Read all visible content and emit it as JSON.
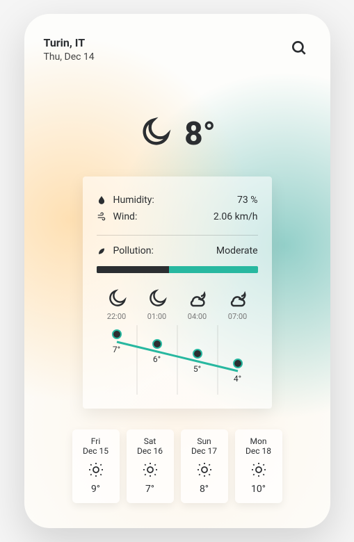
{
  "header": {
    "city": "Turin, IT",
    "date": "Thu, Dec 14"
  },
  "current": {
    "temp": "8°",
    "icon": "moon"
  },
  "details": {
    "humidity_label": "Humidity:",
    "humidity_value": "73 %",
    "wind_label": "Wind:",
    "wind_value": "2.06 km/h",
    "pollution_label": "Pollution:",
    "pollution_value": "Moderate",
    "pollution_fill_pct": 45
  },
  "hourly": [
    {
      "time": "22:00",
      "icon": "moon",
      "temp": "7°",
      "value": 7
    },
    {
      "time": "01:00",
      "icon": "moon",
      "temp": "6°",
      "value": 6
    },
    {
      "time": "04:00",
      "icon": "cloud-moon",
      "temp": "5°",
      "value": 5
    },
    {
      "time": "07:00",
      "icon": "cloud-moon",
      "temp": "4°",
      "value": 4
    }
  ],
  "forecast": [
    {
      "day": "Fri",
      "date": "Dec 15",
      "icon": "sun",
      "temp": "9°"
    },
    {
      "day": "Sat",
      "date": "Dec 16",
      "icon": "sun",
      "temp": "7°"
    },
    {
      "day": "Sun",
      "date": "Dec 17",
      "icon": "sun",
      "temp": "8°"
    },
    {
      "day": "Mon",
      "date": "Dec 18",
      "icon": "sun",
      "temp": "10°"
    }
  ],
  "chart_data": {
    "type": "line",
    "x": [
      "22:00",
      "01:00",
      "04:00",
      "07:00"
    ],
    "values": [
      7,
      6,
      5,
      4
    ],
    "ylim": [
      3,
      8
    ],
    "ylabel": "°"
  }
}
